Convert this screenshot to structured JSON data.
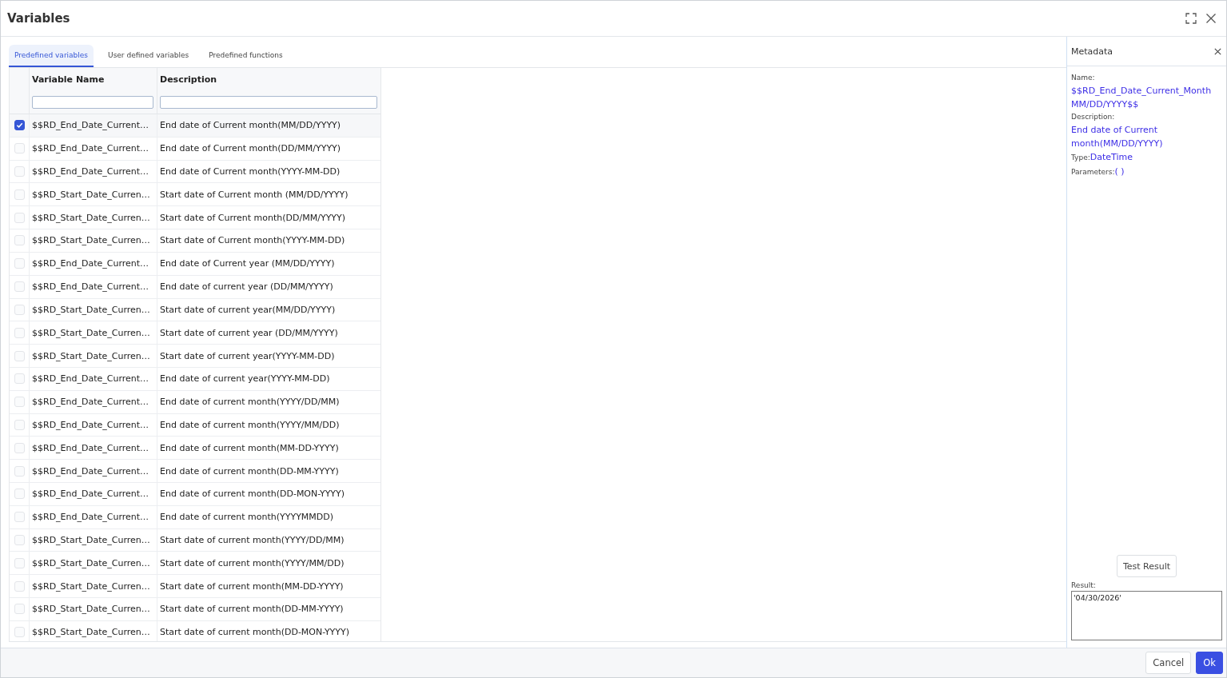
{
  "window": {
    "title": "Variables"
  },
  "tabs": [
    {
      "label": "Predefined variables",
      "selected": true
    },
    {
      "label": "User defined variables",
      "selected": false
    },
    {
      "label": "Predefined functions",
      "selected": false
    }
  ],
  "table": {
    "columns": [
      "Variable Name",
      "Description"
    ],
    "rows": [
      {
        "name": "$$RD_End_Date_Current…",
        "description": "End date of Current month(MM/DD/YYYY)",
        "checked": true
      },
      {
        "name": "$$RD_End_Date_Current…",
        "description": "End date of Current month(DD/MM/YYYY)",
        "checked": false
      },
      {
        "name": "$$RD_End_Date_Current…",
        "description": "End date of Current month(YYYY-MM-DD)",
        "checked": false
      },
      {
        "name": "$$RD_Start_Date_Curren…",
        "description": "Start date of Current month (MM/DD/YYYY)",
        "checked": false
      },
      {
        "name": "$$RD_Start_Date_Curren…",
        "description": "Start date of Current month(DD/MM/YYYY)",
        "checked": false
      },
      {
        "name": "$$RD_Start_Date_Curren…",
        "description": "Start date of Current month(YYYY-MM-DD)",
        "checked": false
      },
      {
        "name": "$$RD_End_Date_Current…",
        "description": "End date of Current year (MM/DD/YYYY)",
        "checked": false
      },
      {
        "name": "$$RD_End_Date_Current…",
        "description": "End date of current year (DD/MM/YYYY)",
        "checked": false
      },
      {
        "name": "$$RD_Start_Date_Curren…",
        "description": "Start date of current year(MM/DD/YYYY)",
        "checked": false
      },
      {
        "name": "$$RD_Start_Date_Curren…",
        "description": "Start date of current year (DD/MM/YYYY)",
        "checked": false
      },
      {
        "name": "$$RD_Start_Date_Curren…",
        "description": "Start date of current year(YYYY-MM-DD)",
        "checked": false
      },
      {
        "name": "$$RD_End_Date_Current…",
        "description": "End date of current year(YYYY-MM-DD)",
        "checked": false
      },
      {
        "name": "$$RD_End_Date_Current…",
        "description": "End date of current month(YYYY/DD/MM)",
        "checked": false
      },
      {
        "name": "$$RD_End_Date_Current…",
        "description": "End date of current month(YYYY/MM/DD)",
        "checked": false
      },
      {
        "name": "$$RD_End_Date_Current…",
        "description": "End date of current month(MM-DD-YYYY)",
        "checked": false
      },
      {
        "name": "$$RD_End_Date_Current…",
        "description": "End date of current month(DD-MM-YYYY)",
        "checked": false
      },
      {
        "name": "$$RD_End_Date_Current…",
        "description": "End date of current month(DD-MON-YYYY)",
        "checked": false
      },
      {
        "name": "$$RD_End_Date_Current…",
        "description": "End date of current month(YYYYMMDD)",
        "checked": false
      },
      {
        "name": "$$RD_Start_Date_Curren…",
        "description": "Start date of current month(YYYY/DD/MM)",
        "checked": false
      },
      {
        "name": "$$RD_Start_Date_Curren…",
        "description": "Start date of current month(YYYY/MM/DD)",
        "checked": false
      },
      {
        "name": "$$RD_Start_Date_Curren…",
        "description": "Start date of current month(MM-DD-YYYY)",
        "checked": false
      },
      {
        "name": "$$RD_Start_Date_Curren…",
        "description": "Start date of current month(DD-MM-YYYY)",
        "checked": false
      },
      {
        "name": "$$RD_Start_Date_Curren…",
        "description": "Start date of current month(DD-MON-YYYY)",
        "checked": false
      }
    ]
  },
  "metadata": {
    "title": "Metadata",
    "fields": [
      {
        "kind": "block",
        "label": "Name:",
        "value": "$$RD_End_Date_Current_Month MM/DD/YYYY$$"
      },
      {
        "kind": "block",
        "label": "Description:",
        "value": "End date of Current month(MM/DD/YYYY)"
      },
      {
        "kind": "inline",
        "label": "Type:",
        "value": "DateTime"
      },
      {
        "kind": "inline",
        "label": "Parameters:",
        "value": "( )"
      }
    ],
    "test_button": "Test Result",
    "result": {
      "label": "Result:",
      "value": "'04/30/2026'"
    }
  },
  "footer": {
    "buttons": [
      {
        "label": "Cancel",
        "kind": "secondary"
      },
      {
        "label": "Ok",
        "kind": "primary"
      }
    ]
  }
}
